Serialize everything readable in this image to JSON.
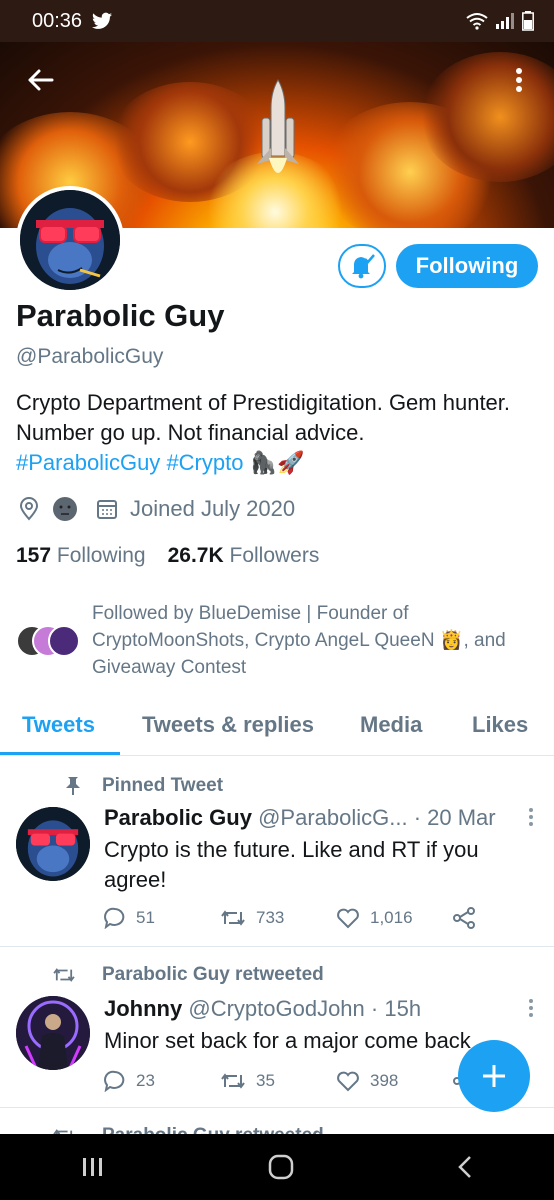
{
  "status_bar": {
    "time": "00:36"
  },
  "profile": {
    "name": "Parabolic Guy",
    "handle": "@ParabolicGuy",
    "bio_text": "Crypto Department of Prestidigitation. Gem hunter. Number go up. Not financial advice.",
    "bio_tag1": "#ParabolicGuy",
    "bio_tag2": "#Crypto",
    "bio_emoji": "🦍🚀",
    "joined": "Joined July 2020",
    "following_count": "157",
    "following_label": "Following",
    "followers_count": "26.7K",
    "followers_label": "Followers",
    "followed_by": "Followed by BlueDemise | Founder of CryptoMoonShots, Crypto AngeL QueeN 👸, and Giveaway Contest"
  },
  "buttons": {
    "following": "Following"
  },
  "tabs": [
    {
      "label": "Tweets"
    },
    {
      "label": "Tweets & replies"
    },
    {
      "label": "Media"
    },
    {
      "label": "Likes"
    }
  ],
  "tweets": [
    {
      "context": "Pinned Tweet",
      "name": "Parabolic Guy",
      "handle": "@ParabolicG...",
      "time": "· 20 Mar",
      "text": "Crypto is the future. Like and RT if you agree!",
      "replies": "51",
      "retweets": "733",
      "likes": "1,016"
    },
    {
      "context": "Parabolic Guy retweeted",
      "name": "Johnny",
      "handle": "@CryptoGodJohn",
      "time": "· 15h",
      "text": "Minor set back for a major come back",
      "replies": "23",
      "retweets": "35",
      "likes": "398"
    },
    {
      "context": "Parabolic Guy retweeted"
    }
  ],
  "colors": {
    "accent": "#1da1f2",
    "muted": "#657786"
  }
}
